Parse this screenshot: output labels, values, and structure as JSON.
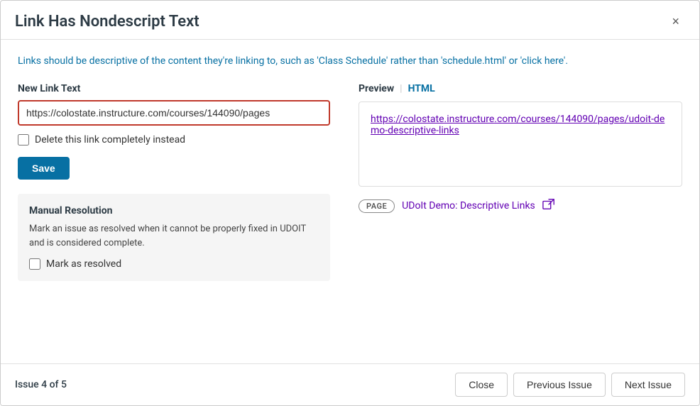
{
  "header": {
    "title": "Link Has Nondescript Text",
    "close_label": "×"
  },
  "body": {
    "description": "Links should be descriptive of the content they're linking to, such as 'Class Schedule' rather than 'schedule.html' or 'click here'.",
    "new_link_text_label": "New Link Text",
    "new_link_text_value": "https://colostate.instructure.com/courses/144090/pages",
    "new_link_text_placeholder": "https://colostate.instructure.com/courses/144090/pages",
    "delete_link_label": "Delete this link completely instead",
    "save_label": "Save",
    "manual_resolution": {
      "title": "Manual Resolution",
      "description": "Mark an issue as resolved when it cannot be properly fixed in UDOIT and is considered complete.",
      "mark_resolved_label": "Mark as resolved"
    },
    "preview": {
      "label": "Preview",
      "html_label": "HTML",
      "link_url": "https://colostate.instructure.com/courses/144090/pages/udoit-demo-descriptive-links",
      "link_display": "https://colostate.instructure.com/courses/144090/pages/udoit-demo-descriptive-links",
      "page_badge": "PAGE",
      "page_title": "UDoIt Demo: Descriptive Links",
      "external_icon": "⊞"
    }
  },
  "footer": {
    "issue_count": "Issue 4 of 5",
    "close_label": "Close",
    "previous_label": "Previous Issue",
    "next_label": "Next Issue"
  },
  "colors": {
    "accent_blue": "#0770a3",
    "link_purple": "#6200b3",
    "border_red": "#c0392b"
  }
}
